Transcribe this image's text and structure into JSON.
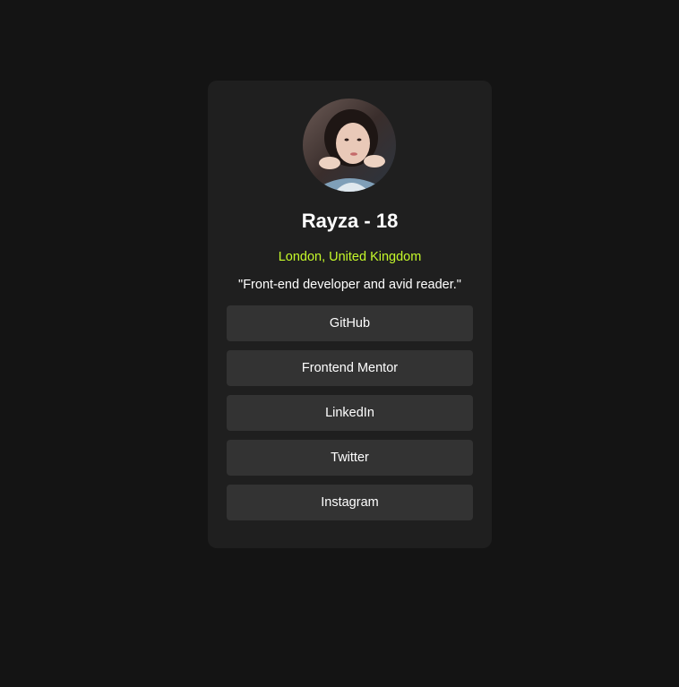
{
  "profile": {
    "name": "Rayza - 18",
    "location": "London, United Kingdom",
    "bio": "\"Front-end developer and avid reader.\"",
    "avatar_icon": "profile-photo"
  },
  "links": [
    {
      "label": "GitHub"
    },
    {
      "label": "Frontend Mentor"
    },
    {
      "label": "LinkedIn"
    },
    {
      "label": "Twitter"
    },
    {
      "label": "Instagram"
    }
  ],
  "colors": {
    "page_background": "#141414",
    "card_background": "#1f1f1f",
    "button_background": "#333333",
    "accent": "#c4f82a",
    "text": "#ffffff"
  }
}
